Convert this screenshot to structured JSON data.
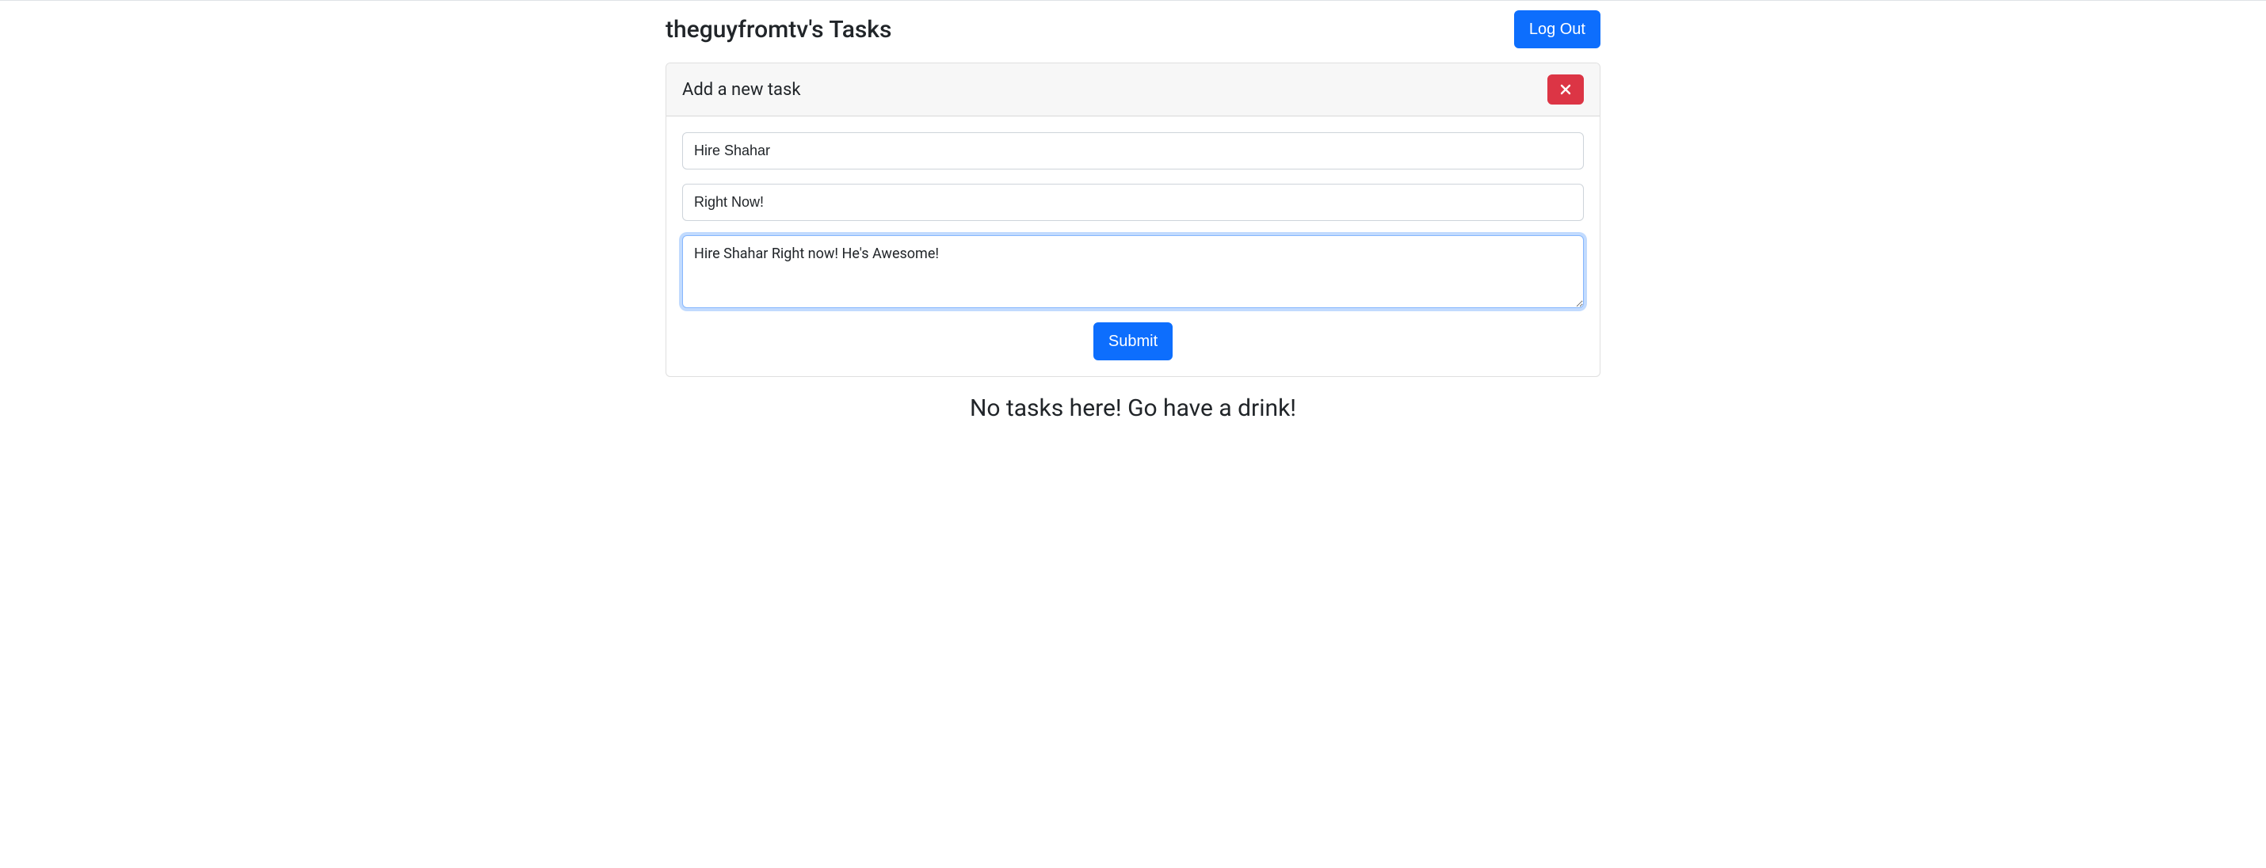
{
  "header": {
    "title": "theguyfromtv's Tasks",
    "logout_label": "Log Out"
  },
  "card": {
    "header_label": "Add a new task",
    "close_icon": "close"
  },
  "form": {
    "task_title_value": "Hire Shahar",
    "task_when_value": "Right Now!",
    "task_desc_value": "Hire Shahar Right now! He's Awesome!",
    "submit_label": "Submit"
  },
  "empty_state": {
    "message": "No tasks here! Go have a drink!"
  }
}
